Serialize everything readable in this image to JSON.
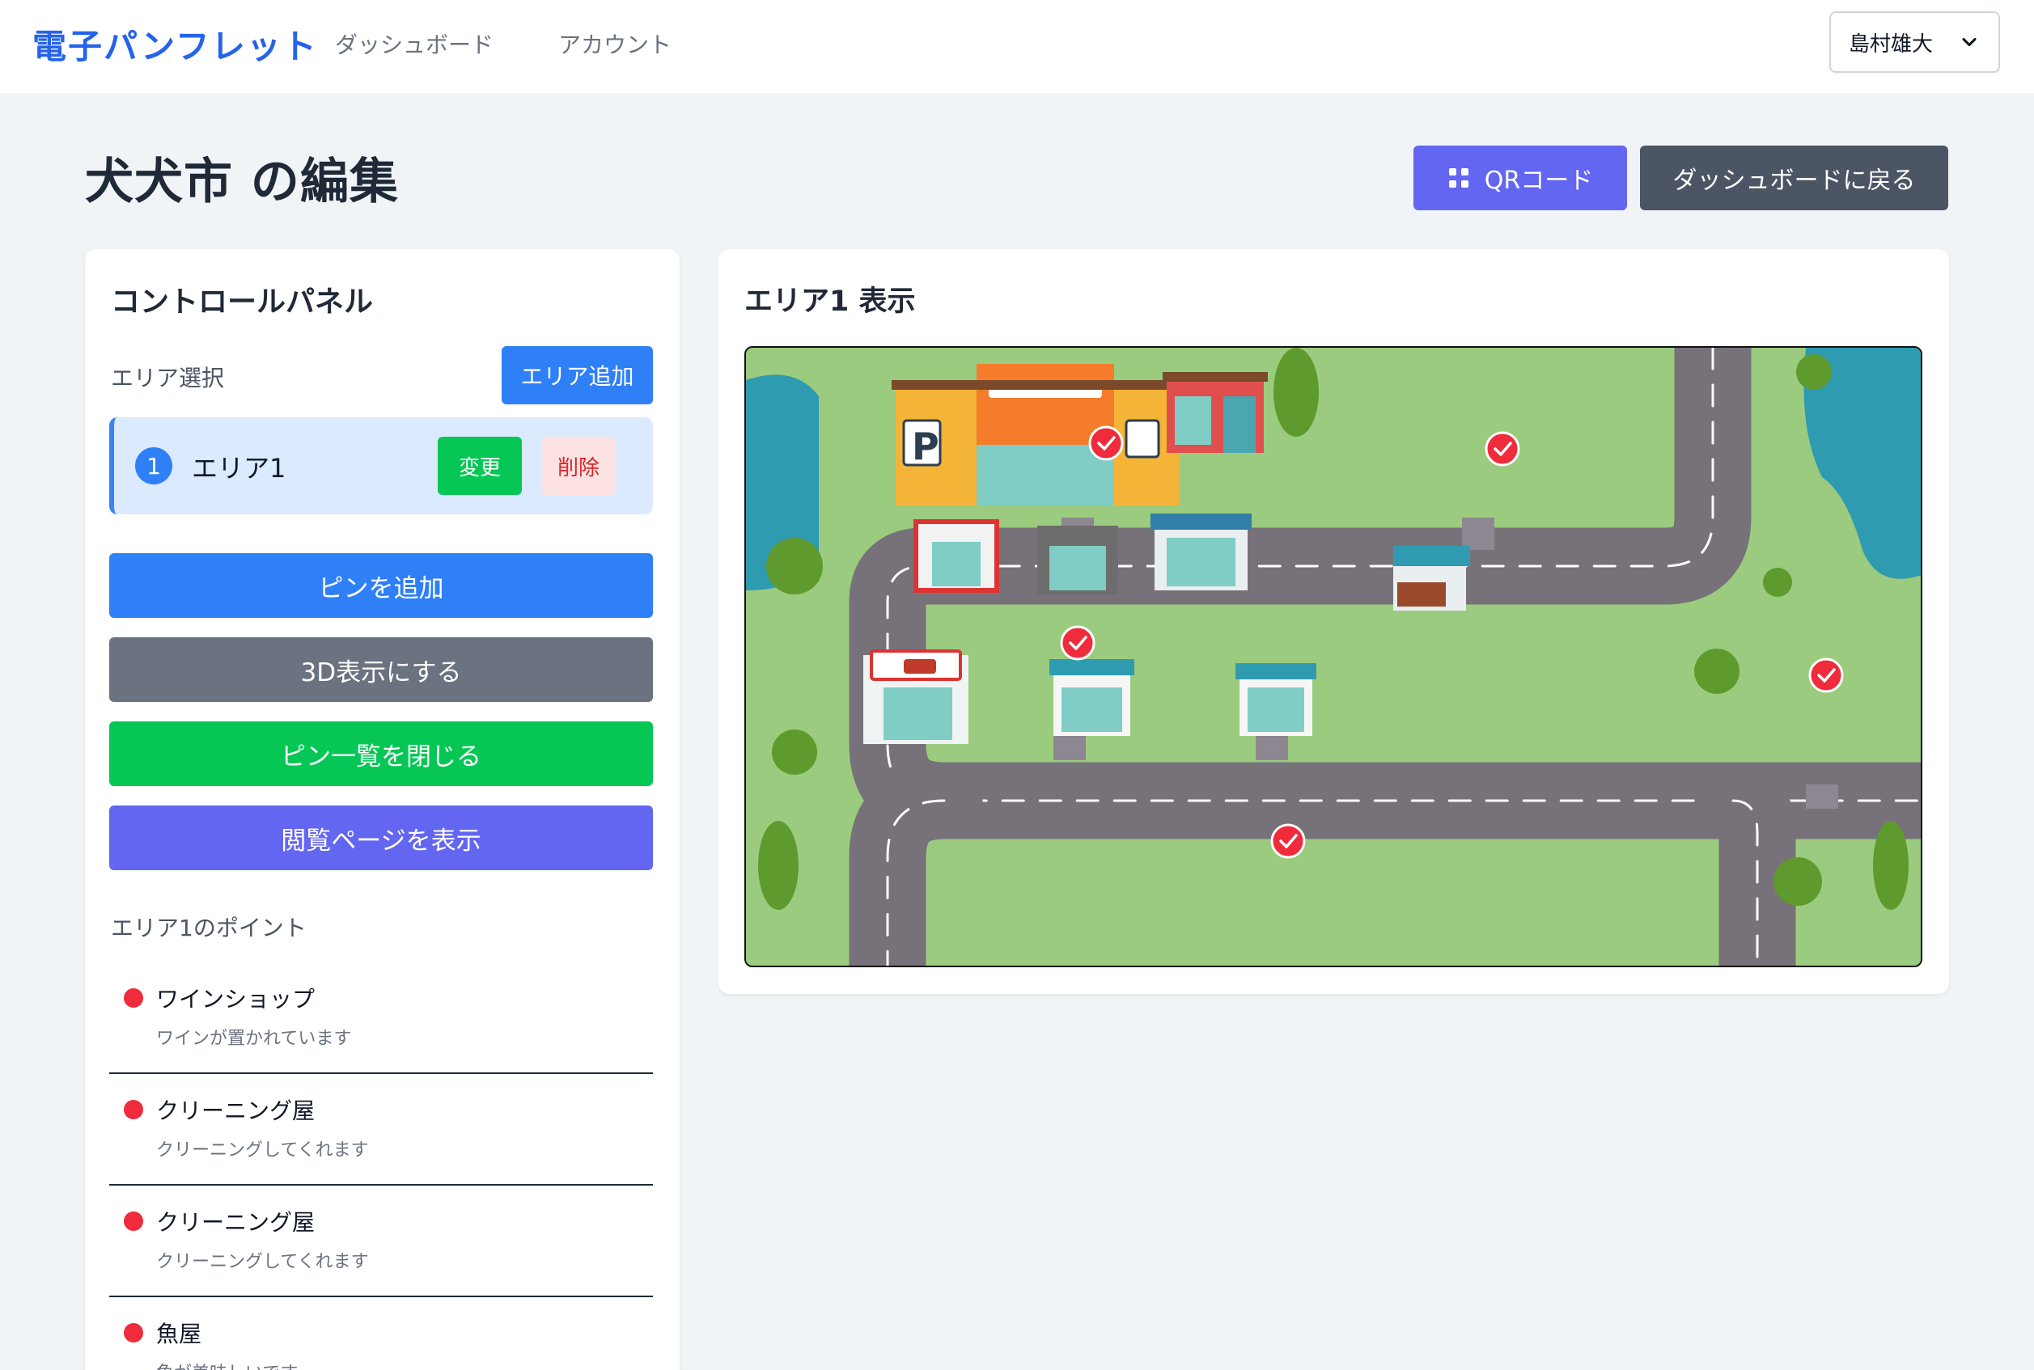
{
  "nav": {
    "brand": "電子パンフレット",
    "links": [
      "ダッシュボード",
      "アカウント"
    ],
    "user": "島村雄大"
  },
  "header": {
    "title": "犬犬市 の編集",
    "qr_label": "QRコード",
    "back_label": "ダッシュボードに戻る"
  },
  "control": {
    "title": "コントロールパネル",
    "area_select_label": "エリア選択",
    "add_area_label": "エリア追加",
    "areas": [
      {
        "number": "1",
        "name": "エリア1",
        "change_label": "変更",
        "delete_label": "削除"
      }
    ],
    "buttons": {
      "add_pin": "ピンを追加",
      "show_3d": "3D表示にする",
      "close_pins": "ピン一覧を閉じる",
      "view_page": "閲覧ページを表示"
    },
    "points_label": "エリア1のポイント",
    "points": [
      {
        "name": "ワインショップ",
        "desc": "ワインが置かれています"
      },
      {
        "name": "クリーニング屋",
        "desc": "クリーニングしてくれます"
      },
      {
        "name": "クリーニング屋",
        "desc": "クリーニングしてくれます"
      },
      {
        "name": "魚屋",
        "desc": "魚が美味しいです"
      }
    ]
  },
  "view": {
    "title": "エリア1 表示"
  },
  "colors": {
    "primary": "#2f80f7",
    "success": "#06c755",
    "indigo": "#6366f1",
    "gray": "#6b7280",
    "pin": "#ef2b3c"
  }
}
